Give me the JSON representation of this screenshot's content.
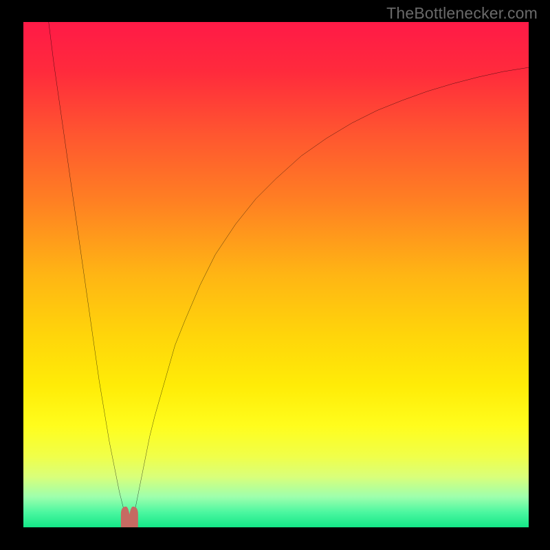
{
  "watermark": "TheBottlenecker.com",
  "chart_data": {
    "type": "line",
    "title": "",
    "xlabel": "",
    "ylabel": "",
    "xlim": [
      0,
      100
    ],
    "ylim": [
      0,
      100
    ],
    "minimum_x": 21,
    "background_gradient": {
      "orientation": "vertical",
      "stops": [
        {
          "pos": 0.0,
          "color": "#ff1a47"
        },
        {
          "pos": 0.1,
          "color": "#ff2b3c"
        },
        {
          "pos": 0.22,
          "color": "#ff5530"
        },
        {
          "pos": 0.35,
          "color": "#ff7e23"
        },
        {
          "pos": 0.5,
          "color": "#ffb514"
        },
        {
          "pos": 0.62,
          "color": "#ffd50a"
        },
        {
          "pos": 0.72,
          "color": "#ffec07"
        },
        {
          "pos": 0.8,
          "color": "#fffd1d"
        },
        {
          "pos": 0.86,
          "color": "#f0ff4a"
        },
        {
          "pos": 0.9,
          "color": "#d9ff7a"
        },
        {
          "pos": 0.94,
          "color": "#9dffad"
        },
        {
          "pos": 0.97,
          "color": "#4cf7a0"
        },
        {
          "pos": 1.0,
          "color": "#13e687"
        }
      ]
    },
    "series": [
      {
        "name": "curve",
        "color": "#000000",
        "x": [
          5,
          6,
          7,
          8,
          9,
          10,
          11,
          12,
          13,
          14,
          15,
          16,
          17,
          18,
          19,
          20,
          21,
          22,
          23,
          24,
          25,
          26,
          28,
          30,
          32,
          35,
          38,
          42,
          46,
          50,
          55,
          60,
          65,
          70,
          75,
          80,
          85,
          90,
          95,
          100
        ],
        "y": [
          100,
          92,
          85,
          78,
          71,
          64,
          57,
          50,
          43,
          36,
          29,
          23,
          17,
          12,
          7,
          3,
          0,
          3,
          8,
          13,
          18,
          22,
          29,
          36,
          41,
          48,
          54,
          60,
          65,
          69,
          73.5,
          77,
          80,
          82.5,
          84.5,
          86.3,
          87.8,
          89.1,
          90.2,
          91
        ]
      }
    ],
    "annotations": [
      {
        "name": "min-marker",
        "type": "bump",
        "color": "#c66a62",
        "x": 21,
        "width_pct": 3.2,
        "height_pct": 4
      }
    ]
  }
}
